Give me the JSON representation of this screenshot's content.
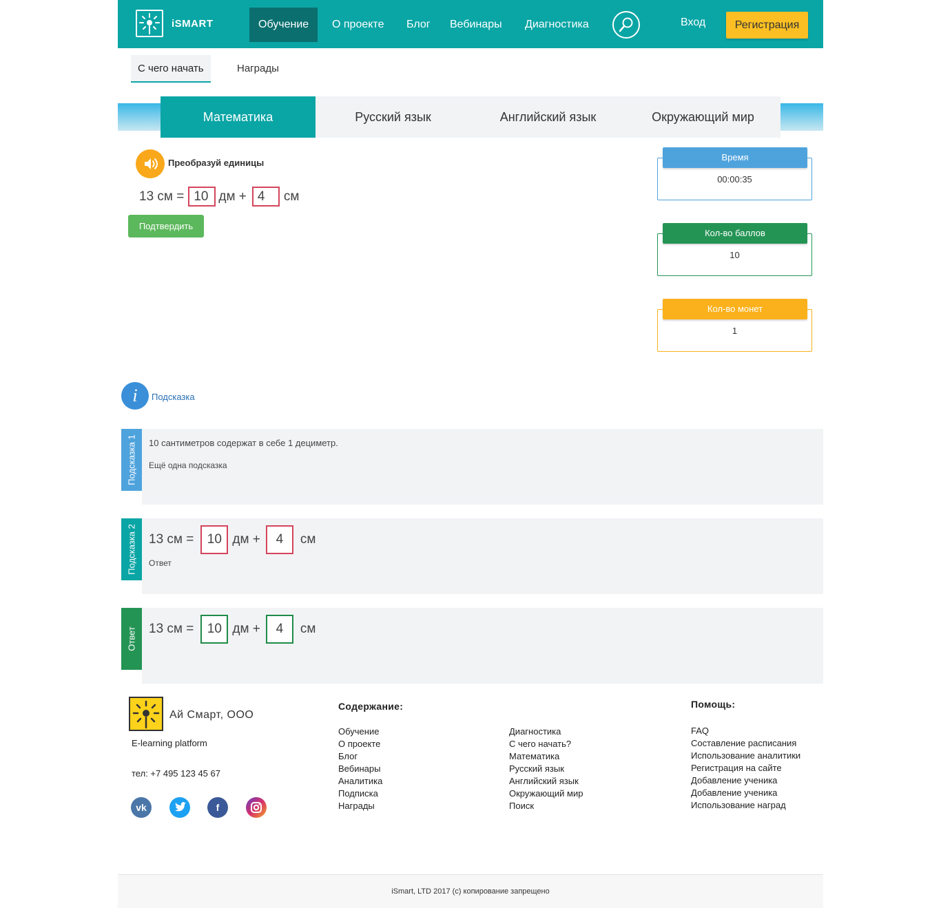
{
  "header": {
    "logo_text": "iSMART",
    "nav": [
      "Обучение",
      "О проекте",
      "Блог",
      "Вебинары",
      "Диагностика"
    ],
    "login": "Вход",
    "register": "Регистрация"
  },
  "subnav": [
    "С чего начать",
    "Награды"
  ],
  "subjects": [
    "Математика",
    "Русский язык",
    "Английский язык",
    "Окружающий мир"
  ],
  "task": {
    "title": "Преобразуй единицы",
    "lhs": "13 см =",
    "value1": "10",
    "unit1": "дм +",
    "value2": "4",
    "unit2": "см",
    "confirm": "Подтвердить"
  },
  "stats": {
    "time_label": "Время",
    "time_value": "00:00:35",
    "points_label": "Кол-во баллов",
    "points_value": "10",
    "coins_label": "Кол-во монет",
    "coins_value": "1",
    "colors": {
      "time": "#4fa3dd",
      "points": "#249455",
      "coins": "#fbb11c"
    }
  },
  "hint": {
    "link": "Подсказка",
    "hint1_tab": "Подсказка 1",
    "hint1_text": "10 сантиметров содержат в себе 1 дециметр.",
    "hint1_sub": "Ещё одна подсказка",
    "hint2_tab": "Подсказка 2",
    "hint2_sub": "Ответ",
    "answer_tab": "Ответ"
  },
  "footer": {
    "company": "Ай Смарт, ООО",
    "tagline": "E-learning platform",
    "phone": "тел: +7 495 123 45 67",
    "contents_head": "Содержание:",
    "col1": [
      "Обучение",
      "О проекте",
      "Блог",
      "Вебинары",
      "Аналитика",
      "Подписка",
      "Награды"
    ],
    "col2": [
      "Диагностика",
      "С чего начать?",
      "Математика",
      "Русский язык",
      "Английский язык",
      "Окружающий мир",
      "Поиск"
    ],
    "help_head": "Помощь:",
    "help": [
      "FAQ",
      "Составление расписания",
      "Использование аналитики",
      "Регистрация на сайте",
      "Добавление ученика",
      "Добавление ученика",
      "Использование наград"
    ],
    "social": [
      "vk-icon",
      "twitter-icon",
      "facebook-icon",
      "instagram-icon"
    ],
    "copyright": "iSmart, LTD 2017 (c) копирование запрещено"
  }
}
